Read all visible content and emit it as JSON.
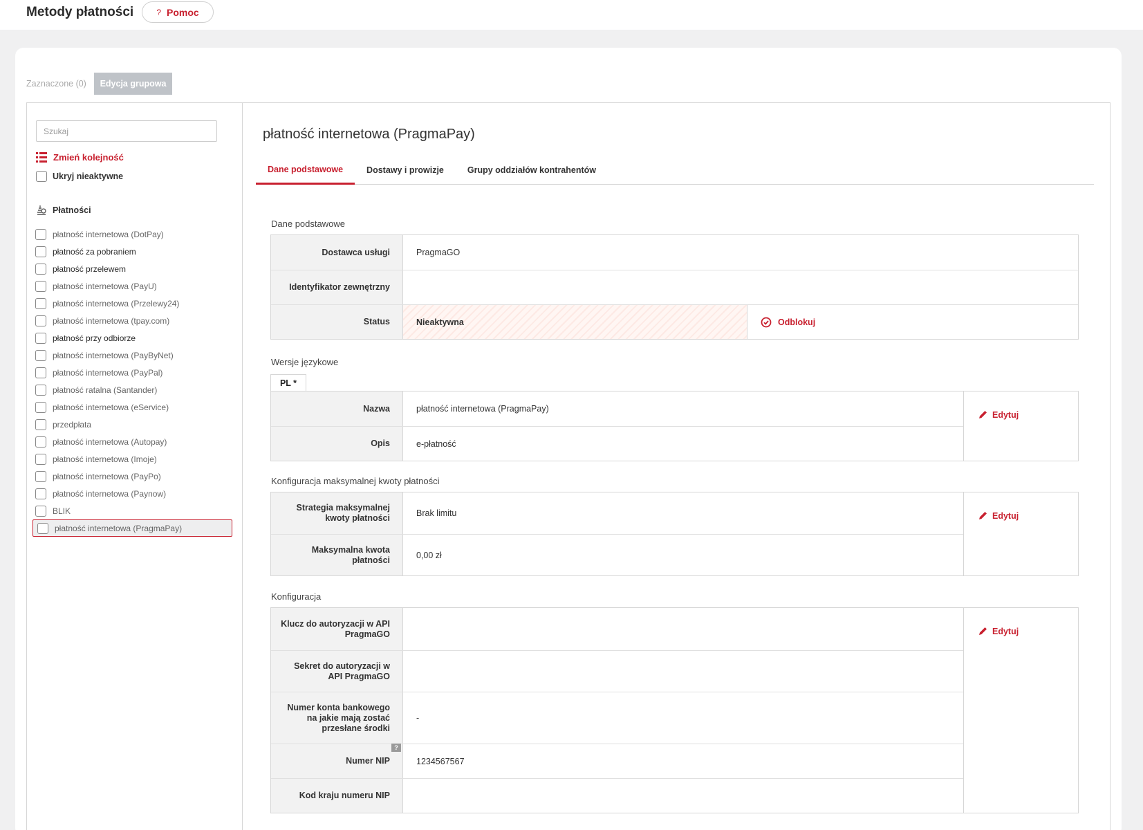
{
  "header": {
    "title": "Metody płatności",
    "help_label": "Pomoc",
    "help_icon": "?"
  },
  "toolbar": {
    "selected_label": "Zaznaczone (0)",
    "bulk_edit_label": "Edycja grupowa"
  },
  "sidebar": {
    "search_placeholder": "Szukaj",
    "reorder_label": "Zmień kolejność",
    "hide_inactive_label": "Ukryj nieaktywne",
    "section_label": "Płatności",
    "items": [
      {
        "label": "płatność internetowa (DotPay)"
      },
      {
        "label": "płatność za pobraniem"
      },
      {
        "label": "płatność przelewem"
      },
      {
        "label": "płatność internetowa (PayU)"
      },
      {
        "label": "płatność internetowa (Przelewy24)"
      },
      {
        "label": "płatność internetowa (tpay.com)"
      },
      {
        "label": "płatność przy odbiorze"
      },
      {
        "label": "płatność internetowa (PayByNet)"
      },
      {
        "label": "płatność internetowa (PayPal)"
      },
      {
        "label": "płatność ratalna (Santander)"
      },
      {
        "label": "płatność internetowa (eService)"
      },
      {
        "label": "przedpłata"
      },
      {
        "label": "płatność internetowa (Autopay)"
      },
      {
        "label": "płatność internetowa (Imoje)"
      },
      {
        "label": "płatność internetowa (PayPo)"
      },
      {
        "label": "płatność internetowa (Paynow)"
      },
      {
        "label": "BLIK"
      },
      {
        "label": "płatność internetowa (PragmaPay)"
      }
    ],
    "selected_index": 17
  },
  "main": {
    "title": "płatność internetowa (PragmaPay)",
    "tabs": [
      {
        "label": "Dane podstawowe",
        "active": true
      },
      {
        "label": "Dostawy i prowizje",
        "active": false
      },
      {
        "label": "Grupy oddziałów kontrahentów",
        "active": false
      }
    ],
    "basic": {
      "section_title": "Dane podstawowe",
      "provider_label": "Dostawca usługi",
      "provider_value": "PragmaGO",
      "external_id_label": "Identyfikator zewnętrzny",
      "external_id_value": "",
      "status_label": "Status",
      "status_value": "Nieaktywna",
      "unlock_label": "Odblokuj"
    },
    "lang": {
      "section_title": "Wersje językowe",
      "tab_label": "PL *",
      "name_label": "Nazwa",
      "name_value": "płatność internetowa (PragmaPay)",
      "desc_label": "Opis",
      "desc_value": "e-płatność",
      "edit_label": "Edytuj"
    },
    "max_amount": {
      "section_title": "Konfiguracja maksymalnej kwoty płatności",
      "strategy_label": "Strategia maksymalnej kwoty płatności",
      "strategy_value": "Brak limitu",
      "max_label": "Maksymalna kwota płatności",
      "max_value": "0,00 zł",
      "edit_label": "Edytuj"
    },
    "config": {
      "section_title": "Konfiguracja",
      "api_key_label": "Klucz do autoryzacji w API PragmaGO",
      "api_key_value": "",
      "api_secret_label": "Sekret do autoryzacji w API PragmaGO",
      "api_secret_value": "",
      "bank_account_label": "Numer konta bankowego na jakie mają zostać przesłane środki",
      "bank_account_value": "-",
      "nip_hint": "?",
      "nip_label": "Numer NIP",
      "nip_value": "1234567567",
      "nip_country_label": "Kod kraju numeru NIP",
      "nip_country_value": "",
      "edit_label": "Edytuj"
    }
  },
  "colors": {
    "accent": "#c8202f",
    "label_bg": "#f2f2f2",
    "page_bg": "#f0f0f1"
  }
}
